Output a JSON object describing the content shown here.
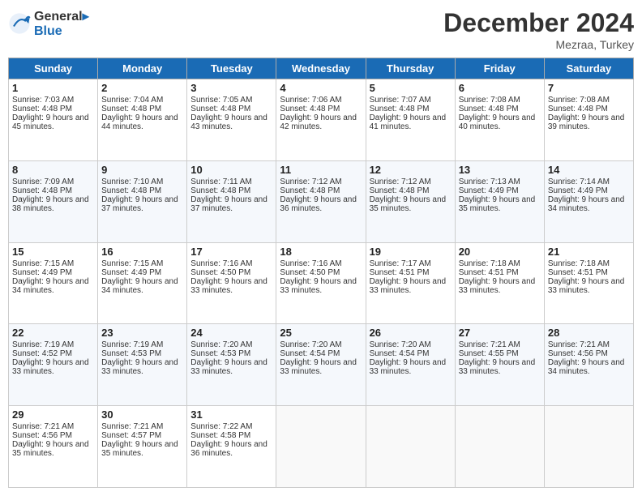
{
  "header": {
    "logo_line1": "General",
    "logo_line2": "Blue",
    "month_title": "December 2024",
    "location": "Mezraa, Turkey"
  },
  "days_of_week": [
    "Sunday",
    "Monday",
    "Tuesday",
    "Wednesday",
    "Thursday",
    "Friday",
    "Saturday"
  ],
  "weeks": [
    [
      {
        "day": "1",
        "sunrise": "7:03 AM",
        "sunset": "4:48 PM",
        "daylight": "9 hours and 45 minutes."
      },
      {
        "day": "2",
        "sunrise": "7:04 AM",
        "sunset": "4:48 PM",
        "daylight": "9 hours and 44 minutes."
      },
      {
        "day": "3",
        "sunrise": "7:05 AM",
        "sunset": "4:48 PM",
        "daylight": "9 hours and 43 minutes."
      },
      {
        "day": "4",
        "sunrise": "7:06 AM",
        "sunset": "4:48 PM",
        "daylight": "9 hours and 42 minutes."
      },
      {
        "day": "5",
        "sunrise": "7:07 AM",
        "sunset": "4:48 PM",
        "daylight": "9 hours and 41 minutes."
      },
      {
        "day": "6",
        "sunrise": "7:08 AM",
        "sunset": "4:48 PM",
        "daylight": "9 hours and 40 minutes."
      },
      {
        "day": "7",
        "sunrise": "7:08 AM",
        "sunset": "4:48 PM",
        "daylight": "9 hours and 39 minutes."
      }
    ],
    [
      {
        "day": "8",
        "sunrise": "7:09 AM",
        "sunset": "4:48 PM",
        "daylight": "9 hours and 38 minutes."
      },
      {
        "day": "9",
        "sunrise": "7:10 AM",
        "sunset": "4:48 PM",
        "daylight": "9 hours and 37 minutes."
      },
      {
        "day": "10",
        "sunrise": "7:11 AM",
        "sunset": "4:48 PM",
        "daylight": "9 hours and 37 minutes."
      },
      {
        "day": "11",
        "sunrise": "7:12 AM",
        "sunset": "4:48 PM",
        "daylight": "9 hours and 36 minutes."
      },
      {
        "day": "12",
        "sunrise": "7:12 AM",
        "sunset": "4:48 PM",
        "daylight": "9 hours and 35 minutes."
      },
      {
        "day": "13",
        "sunrise": "7:13 AM",
        "sunset": "4:49 PM",
        "daylight": "9 hours and 35 minutes."
      },
      {
        "day": "14",
        "sunrise": "7:14 AM",
        "sunset": "4:49 PM",
        "daylight": "9 hours and 34 minutes."
      }
    ],
    [
      {
        "day": "15",
        "sunrise": "7:15 AM",
        "sunset": "4:49 PM",
        "daylight": "9 hours and 34 minutes."
      },
      {
        "day": "16",
        "sunrise": "7:15 AM",
        "sunset": "4:49 PM",
        "daylight": "9 hours and 34 minutes."
      },
      {
        "day": "17",
        "sunrise": "7:16 AM",
        "sunset": "4:50 PM",
        "daylight": "9 hours and 33 minutes."
      },
      {
        "day": "18",
        "sunrise": "7:16 AM",
        "sunset": "4:50 PM",
        "daylight": "9 hours and 33 minutes."
      },
      {
        "day": "19",
        "sunrise": "7:17 AM",
        "sunset": "4:51 PM",
        "daylight": "9 hours and 33 minutes."
      },
      {
        "day": "20",
        "sunrise": "7:18 AM",
        "sunset": "4:51 PM",
        "daylight": "9 hours and 33 minutes."
      },
      {
        "day": "21",
        "sunrise": "7:18 AM",
        "sunset": "4:51 PM",
        "daylight": "9 hours and 33 minutes."
      }
    ],
    [
      {
        "day": "22",
        "sunrise": "7:19 AM",
        "sunset": "4:52 PM",
        "daylight": "9 hours and 33 minutes."
      },
      {
        "day": "23",
        "sunrise": "7:19 AM",
        "sunset": "4:53 PM",
        "daylight": "9 hours and 33 minutes."
      },
      {
        "day": "24",
        "sunrise": "7:20 AM",
        "sunset": "4:53 PM",
        "daylight": "9 hours and 33 minutes."
      },
      {
        "day": "25",
        "sunrise": "7:20 AM",
        "sunset": "4:54 PM",
        "daylight": "9 hours and 33 minutes."
      },
      {
        "day": "26",
        "sunrise": "7:20 AM",
        "sunset": "4:54 PM",
        "daylight": "9 hours and 33 minutes."
      },
      {
        "day": "27",
        "sunrise": "7:21 AM",
        "sunset": "4:55 PM",
        "daylight": "9 hours and 33 minutes."
      },
      {
        "day": "28",
        "sunrise": "7:21 AM",
        "sunset": "4:56 PM",
        "daylight": "9 hours and 34 minutes."
      }
    ],
    [
      {
        "day": "29",
        "sunrise": "7:21 AM",
        "sunset": "4:56 PM",
        "daylight": "9 hours and 35 minutes."
      },
      {
        "day": "30",
        "sunrise": "7:21 AM",
        "sunset": "4:57 PM",
        "daylight": "9 hours and 35 minutes."
      },
      {
        "day": "31",
        "sunrise": "7:22 AM",
        "sunset": "4:58 PM",
        "daylight": "9 hours and 36 minutes."
      },
      null,
      null,
      null,
      null
    ]
  ],
  "labels": {
    "sunrise": "Sunrise:",
    "sunset": "Sunset:",
    "daylight": "Daylight:"
  }
}
